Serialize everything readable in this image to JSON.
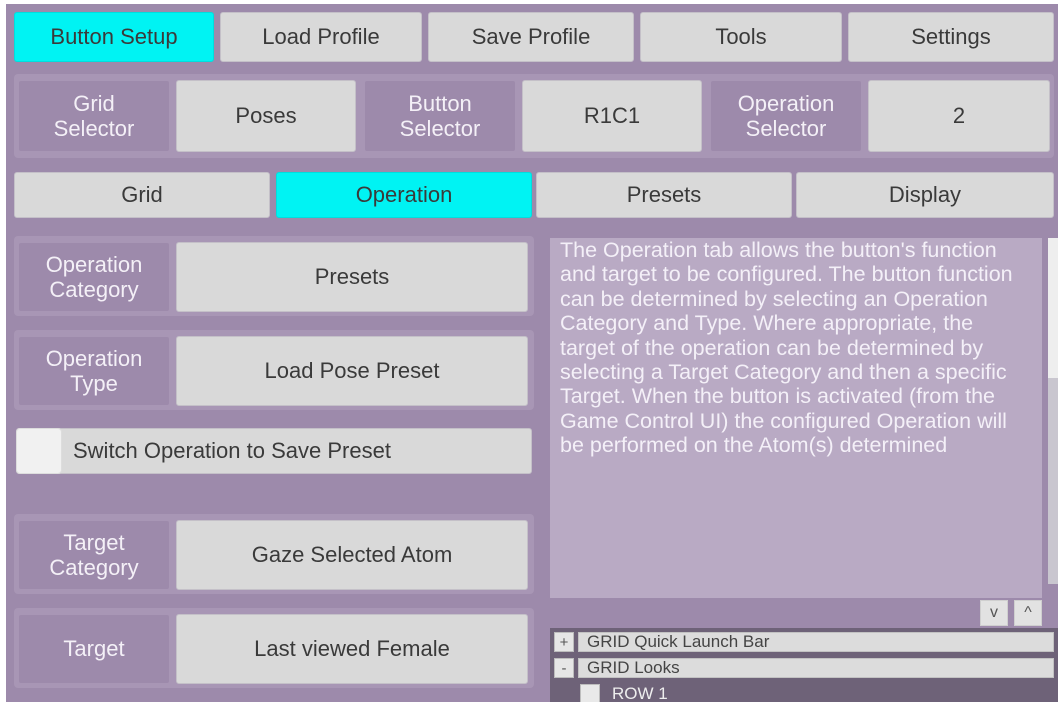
{
  "tabs": [
    {
      "label": "Button Setup",
      "active": true
    },
    {
      "label": "Load Profile",
      "active": false
    },
    {
      "label": "Save Profile",
      "active": false
    },
    {
      "label": "Tools",
      "active": false
    },
    {
      "label": "Settings",
      "active": false
    }
  ],
  "selectors": {
    "grid_label": "Grid\nSelector",
    "grid_value": "Poses",
    "button_label": "Button\nSelector",
    "button_value": "R1C1",
    "operation_label": "Operation\nSelector",
    "operation_value": "2"
  },
  "subtabs": [
    {
      "label": "Grid",
      "active": false
    },
    {
      "label": "Operation",
      "active": true
    },
    {
      "label": "Presets",
      "active": false
    },
    {
      "label": "Display",
      "active": false
    }
  ],
  "fields": {
    "operation_category_label": "Operation\nCategory",
    "operation_category_value": "Presets",
    "operation_type_label": "Operation\nType",
    "operation_type_value": "Load Pose Preset",
    "switch_label": "Switch Operation to Save Preset",
    "target_category_label": "Target\nCategory",
    "target_category_value": "Gaze Selected Atom",
    "target_label": "Target",
    "target_value": "Last viewed Female"
  },
  "help": {
    "text": "The Operation tab allows the button's function and target to be configured. The button function can be determined by selecting an Operation Category and Type. Where appropriate, the target of the operation can be determined by selecting a Target Category and then a specific Target. When the button is activated (from the Game Control UI) the configured Operation will be performed on the Atom(s) determined"
  },
  "scroll_buttons": {
    "down": "v",
    "up": "^"
  },
  "tree": [
    {
      "toggle": "+",
      "label": "GRID Quick Launch Bar"
    },
    {
      "toggle": "-",
      "label": "GRID Looks"
    },
    {
      "toggle": "",
      "label": "ROW 1"
    }
  ],
  "colors": {
    "panel": "#9d8aab",
    "active": "#00f3f3",
    "button": "#d9d9d9",
    "help_bg": "#b9aac4"
  }
}
